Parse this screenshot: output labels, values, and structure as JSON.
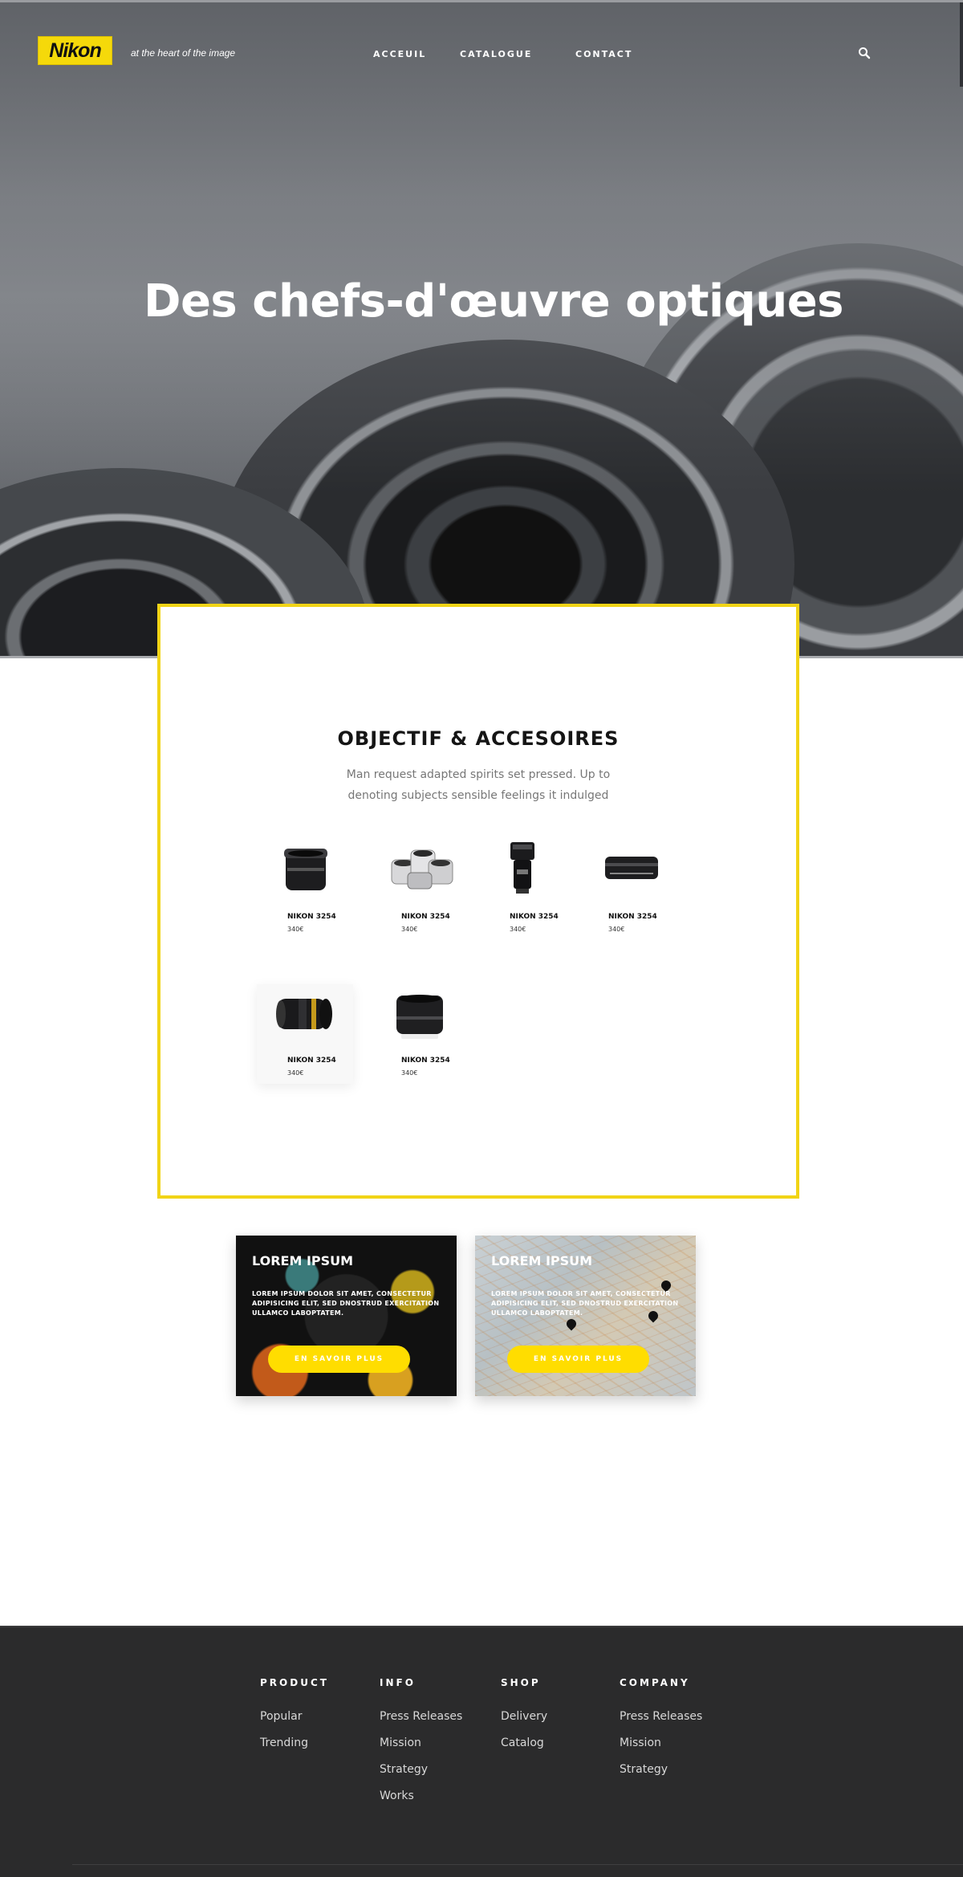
{
  "header": {
    "logo_text": "Nikon",
    "tagline": "at the heart of the image",
    "nav": [
      "ACCEUIL",
      "CATALOGUE",
      "CONTACT"
    ],
    "search_icon": "search-icon"
  },
  "hero": {
    "title": "Des chefs-d'œuvre optiques"
  },
  "catalog": {
    "title": "OBJECTIF & ACCESOIRES",
    "subtitle": "Man request adapted spirits set pressed. Up to denoting subjects sensible feelings it indulged",
    "products": [
      {
        "name": "NIKON 3254",
        "price": "340€",
        "image": "lens-icon"
      },
      {
        "name": "NIKON 3254",
        "price": "340€",
        "image": "lens-kit-icon"
      },
      {
        "name": "NIKON 3254",
        "price": "340€",
        "image": "flash-icon"
      },
      {
        "name": "NIKON 3254",
        "price": "340€",
        "image": "pancake-lens-icon"
      },
      {
        "name": "NIKON 3254",
        "price": "340€",
        "image": "zoom-lens-icon"
      },
      {
        "name": "NIKON 3254",
        "price": "340€",
        "image": "prime-lens-icon"
      }
    ]
  },
  "promos": [
    {
      "title": "LOREM IPSUM",
      "text": "LOREM IPSUM DOLOR SIT AMET, CONSECTETUR ADIPISICING ELIT, SED DNOSTRUD EXERCITATION ULLAMCO LABOPTATEM.",
      "button": "EN SAVOIR PLUS"
    },
    {
      "title": "LOREM IPSUM",
      "text": "LOREM IPSUM DOLOR SIT AMET, CONSECTETUR ADIPISICING ELIT, SED DNOSTRUD EXERCITATION ULLAMCO LABOPTATEM.",
      "button": "EN SAVOIR PLUS"
    }
  ],
  "footer": {
    "columns": [
      {
        "heading": "PRODUCT",
        "links": [
          "Popular",
          "Trending"
        ]
      },
      {
        "heading": "INFO",
        "links": [
          "Press Releases",
          "Mission",
          "Strategy",
          "Works"
        ]
      },
      {
        "heading": "SHOP",
        "links": [
          "Delivery",
          "Catalog"
        ]
      },
      {
        "heading": "COMPANY",
        "links": [
          "Press Releases",
          "Mission",
          "Strategy"
        ]
      }
    ]
  },
  "colors": {
    "accent": "#ffdd00",
    "frame": "#f1d416",
    "footer_bg": "#2b2b2c"
  }
}
